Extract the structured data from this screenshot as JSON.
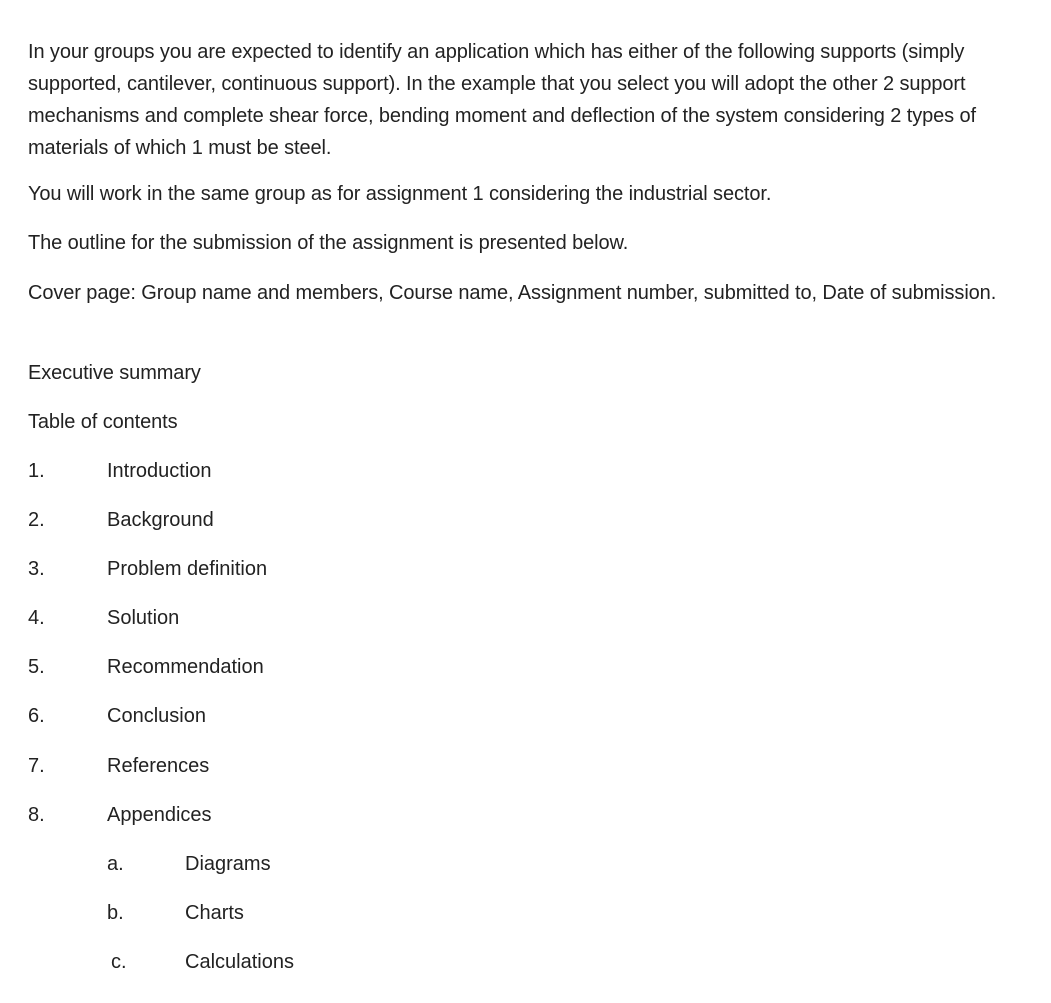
{
  "paragraphs": {
    "intro": "In your groups you are expected to identify an application which has either of the following supports (simply supported, cantilever, continuous support). In the example that you select you will adopt the other 2 support mechanisms and complete shear force, bending moment and deflection of the system considering 2 types of materials of which 1 must be steel.",
    "group": "You will work in the same group as for assignment 1 considering the industrial sector.",
    "outline": "The outline for the submission of the assignment is presented below.",
    "cover": "Cover page: Group name and members, Course name, Assignment number, submitted to, Date of submission.",
    "exec_summary": "Executive summary",
    "toc": "Table of contents"
  },
  "outline_items": [
    {
      "num": "1.",
      "label": "Introduction"
    },
    {
      "num": "2.",
      "label": "Background"
    },
    {
      "num": "3.",
      "label": "Problem definition"
    },
    {
      "num": "4.",
      "label": "Solution"
    },
    {
      "num": "5.",
      "label": "Recommendation"
    },
    {
      "num": "6.",
      "label": "Conclusion"
    },
    {
      "num": "7.",
      "label": "References"
    },
    {
      "num": "8.",
      "label": "Appendices"
    }
  ],
  "appendix_items": [
    {
      "num": "a.",
      "label": "Diagrams"
    },
    {
      "num": "b.",
      "label": "Charts"
    },
    {
      "num": "c.",
      "label": "Calculations"
    }
  ]
}
